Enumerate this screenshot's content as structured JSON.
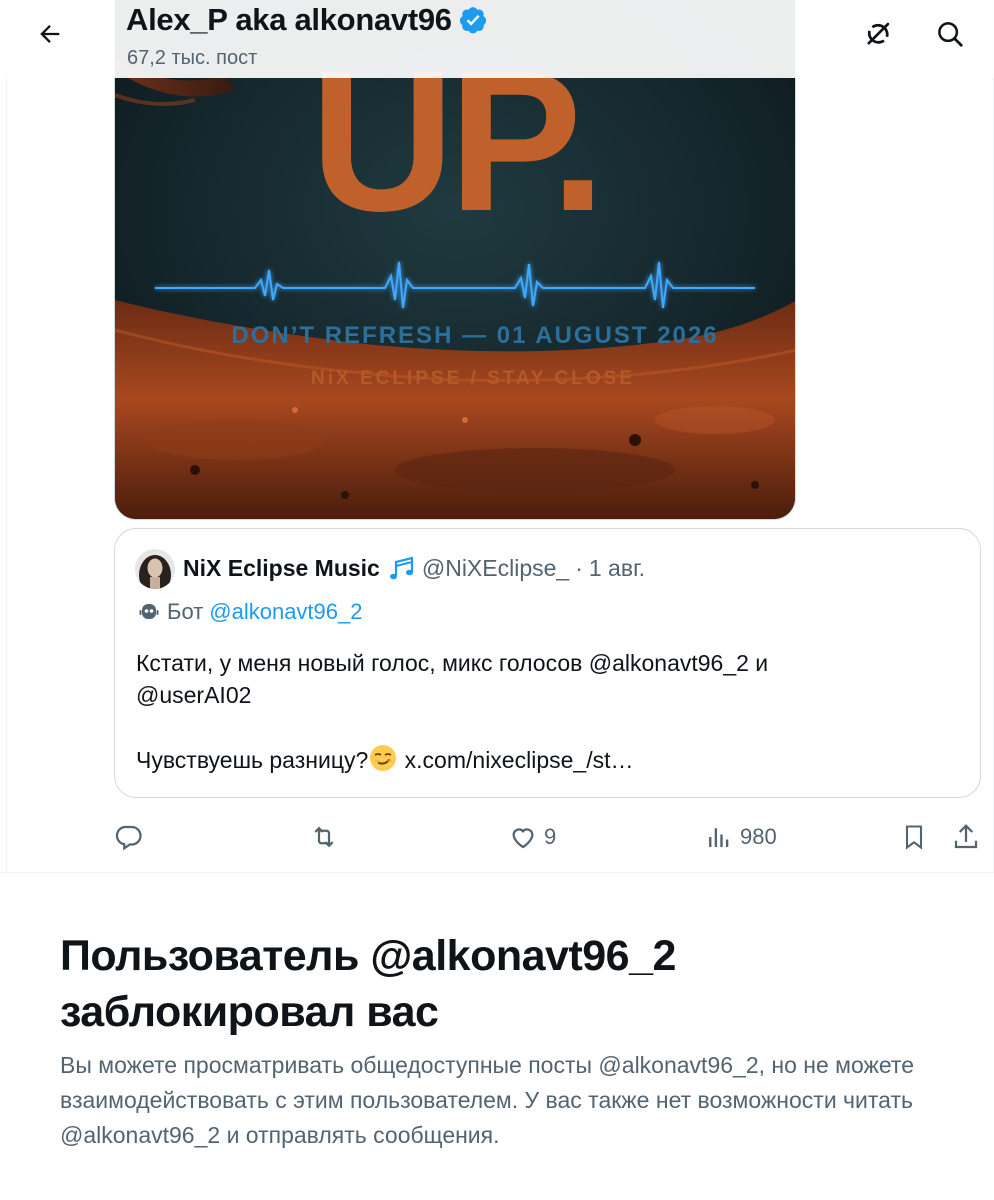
{
  "header": {
    "title": "Alex_P aka alkonavt96",
    "subtitle": "67,2 тыс. пост",
    "icons": [
      "back-arrow-icon",
      "verified-badge-icon",
      "grok-icon",
      "search-icon"
    ],
    "accent_color": "#1d9bf0"
  },
  "media": {
    "title_text": "UP.",
    "line1": "DON’T REFRESH — 01 AUGUST 2026",
    "line2": "NiX ECLIPSE / STAY CLOSE"
  },
  "quote": {
    "name": "NiX Eclipse Music",
    "handle": "@NiXEclipse_",
    "dot": "·",
    "date": "1 авг.",
    "bot_label": "Бот",
    "bot_link": "@alkonavt96_2",
    "text_line1": "Кстати, у меня новый голос, микс голосов @alkonavt96_2 и",
    "text_line2": "@userAI02",
    "text_line3": "Чувствуешь разницу?",
    "text_link": "x.com/nixeclipse_/st…"
  },
  "actions": {
    "likes": "9",
    "views": "980"
  },
  "notice": {
    "title_line1": "Пользователь @alkonavt96_2",
    "title_line2": "заблокировал вас",
    "description": "Вы можете просматривать общедоступные посты @alkonavt96_2, но не можете взаимодействовать с этим пользователем. У вас также нет возможности читать @alkonavt96_2 и отправлять сообщения."
  }
}
